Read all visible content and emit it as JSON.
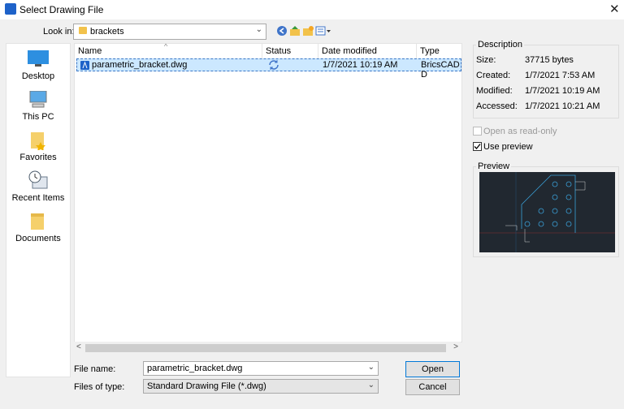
{
  "window": {
    "title": "Select Drawing File"
  },
  "look_in": {
    "label": "Look in:",
    "value": "brackets"
  },
  "places": [
    {
      "label": "Desktop"
    },
    {
      "label": "This PC"
    },
    {
      "label": "Favorites"
    },
    {
      "label": "Recent Items"
    },
    {
      "label": "Documents"
    }
  ],
  "columns": {
    "name": "Name",
    "status": "Status",
    "date": "Date modified",
    "type": "Type"
  },
  "files": [
    {
      "name": "parametric_bracket.dwg",
      "date": "1/7/2021 10:19 AM",
      "type": "BricsCAD D"
    }
  ],
  "file_name": {
    "label": "File name:",
    "value": "parametric_bracket.dwg"
  },
  "file_type": {
    "label": "Files of type:",
    "value": "Standard Drawing File (*.dwg)"
  },
  "buttons": {
    "open": "Open",
    "cancel": "Cancel"
  },
  "description": {
    "title": "Description",
    "size_label": "Size:",
    "size": "37715 bytes",
    "created_label": "Created:",
    "created": "1/7/2021 7:53 AM",
    "modified_label": "Modified:",
    "modified": "1/7/2021 10:19 AM",
    "accessed_label": "Accessed:",
    "accessed": "1/7/2021 10:21 AM"
  },
  "options": {
    "read_only": {
      "label": "Open as read-only",
      "checked": false
    },
    "use_preview": {
      "label": "Use preview",
      "checked": true
    }
  },
  "preview": {
    "title": "Preview"
  },
  "colors": {
    "accent": "#0078d7",
    "selection": "#cce8ff",
    "preview_bg": "#212830",
    "preview_lines": "#3aa0d8"
  }
}
